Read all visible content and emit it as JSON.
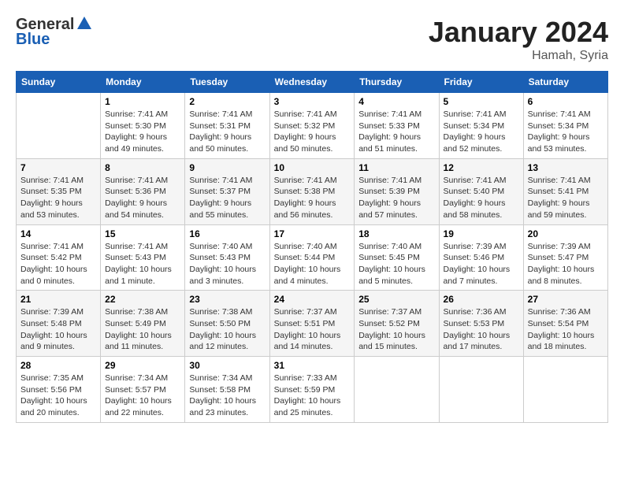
{
  "header": {
    "logo_general": "General",
    "logo_blue": "Blue",
    "month": "January 2024",
    "location": "Hamah, Syria"
  },
  "days_of_week": [
    "Sunday",
    "Monday",
    "Tuesday",
    "Wednesday",
    "Thursday",
    "Friday",
    "Saturday"
  ],
  "weeks": [
    [
      {
        "day": "",
        "sunrise": "",
        "sunset": "",
        "daylight": ""
      },
      {
        "day": "1",
        "sunrise": "Sunrise: 7:41 AM",
        "sunset": "Sunset: 5:30 PM",
        "daylight": "Daylight: 9 hours and 49 minutes."
      },
      {
        "day": "2",
        "sunrise": "Sunrise: 7:41 AM",
        "sunset": "Sunset: 5:31 PM",
        "daylight": "Daylight: 9 hours and 50 minutes."
      },
      {
        "day": "3",
        "sunrise": "Sunrise: 7:41 AM",
        "sunset": "Sunset: 5:32 PM",
        "daylight": "Daylight: 9 hours and 50 minutes."
      },
      {
        "day": "4",
        "sunrise": "Sunrise: 7:41 AM",
        "sunset": "Sunset: 5:33 PM",
        "daylight": "Daylight: 9 hours and 51 minutes."
      },
      {
        "day": "5",
        "sunrise": "Sunrise: 7:41 AM",
        "sunset": "Sunset: 5:34 PM",
        "daylight": "Daylight: 9 hours and 52 minutes."
      },
      {
        "day": "6",
        "sunrise": "Sunrise: 7:41 AM",
        "sunset": "Sunset: 5:34 PM",
        "daylight": "Daylight: 9 hours and 53 minutes."
      }
    ],
    [
      {
        "day": "7",
        "sunrise": "Sunrise: 7:41 AM",
        "sunset": "Sunset: 5:35 PM",
        "daylight": "Daylight: 9 hours and 53 minutes."
      },
      {
        "day": "8",
        "sunrise": "Sunrise: 7:41 AM",
        "sunset": "Sunset: 5:36 PM",
        "daylight": "Daylight: 9 hours and 54 minutes."
      },
      {
        "day": "9",
        "sunrise": "Sunrise: 7:41 AM",
        "sunset": "Sunset: 5:37 PM",
        "daylight": "Daylight: 9 hours and 55 minutes."
      },
      {
        "day": "10",
        "sunrise": "Sunrise: 7:41 AM",
        "sunset": "Sunset: 5:38 PM",
        "daylight": "Daylight: 9 hours and 56 minutes."
      },
      {
        "day": "11",
        "sunrise": "Sunrise: 7:41 AM",
        "sunset": "Sunset: 5:39 PM",
        "daylight": "Daylight: 9 hours and 57 minutes."
      },
      {
        "day": "12",
        "sunrise": "Sunrise: 7:41 AM",
        "sunset": "Sunset: 5:40 PM",
        "daylight": "Daylight: 9 hours and 58 minutes."
      },
      {
        "day": "13",
        "sunrise": "Sunrise: 7:41 AM",
        "sunset": "Sunset: 5:41 PM",
        "daylight": "Daylight: 9 hours and 59 minutes."
      }
    ],
    [
      {
        "day": "14",
        "sunrise": "Sunrise: 7:41 AM",
        "sunset": "Sunset: 5:42 PM",
        "daylight": "Daylight: 10 hours and 0 minutes."
      },
      {
        "day": "15",
        "sunrise": "Sunrise: 7:41 AM",
        "sunset": "Sunset: 5:43 PM",
        "daylight": "Daylight: 10 hours and 1 minute."
      },
      {
        "day": "16",
        "sunrise": "Sunrise: 7:40 AM",
        "sunset": "Sunset: 5:43 PM",
        "daylight": "Daylight: 10 hours and 3 minutes."
      },
      {
        "day": "17",
        "sunrise": "Sunrise: 7:40 AM",
        "sunset": "Sunset: 5:44 PM",
        "daylight": "Daylight: 10 hours and 4 minutes."
      },
      {
        "day": "18",
        "sunrise": "Sunrise: 7:40 AM",
        "sunset": "Sunset: 5:45 PM",
        "daylight": "Daylight: 10 hours and 5 minutes."
      },
      {
        "day": "19",
        "sunrise": "Sunrise: 7:39 AM",
        "sunset": "Sunset: 5:46 PM",
        "daylight": "Daylight: 10 hours and 7 minutes."
      },
      {
        "day": "20",
        "sunrise": "Sunrise: 7:39 AM",
        "sunset": "Sunset: 5:47 PM",
        "daylight": "Daylight: 10 hours and 8 minutes."
      }
    ],
    [
      {
        "day": "21",
        "sunrise": "Sunrise: 7:39 AM",
        "sunset": "Sunset: 5:48 PM",
        "daylight": "Daylight: 10 hours and 9 minutes."
      },
      {
        "day": "22",
        "sunrise": "Sunrise: 7:38 AM",
        "sunset": "Sunset: 5:49 PM",
        "daylight": "Daylight: 10 hours and 11 minutes."
      },
      {
        "day": "23",
        "sunrise": "Sunrise: 7:38 AM",
        "sunset": "Sunset: 5:50 PM",
        "daylight": "Daylight: 10 hours and 12 minutes."
      },
      {
        "day": "24",
        "sunrise": "Sunrise: 7:37 AM",
        "sunset": "Sunset: 5:51 PM",
        "daylight": "Daylight: 10 hours and 14 minutes."
      },
      {
        "day": "25",
        "sunrise": "Sunrise: 7:37 AM",
        "sunset": "Sunset: 5:52 PM",
        "daylight": "Daylight: 10 hours and 15 minutes."
      },
      {
        "day": "26",
        "sunrise": "Sunrise: 7:36 AM",
        "sunset": "Sunset: 5:53 PM",
        "daylight": "Daylight: 10 hours and 17 minutes."
      },
      {
        "day": "27",
        "sunrise": "Sunrise: 7:36 AM",
        "sunset": "Sunset: 5:54 PM",
        "daylight": "Daylight: 10 hours and 18 minutes."
      }
    ],
    [
      {
        "day": "28",
        "sunrise": "Sunrise: 7:35 AM",
        "sunset": "Sunset: 5:56 PM",
        "daylight": "Daylight: 10 hours and 20 minutes."
      },
      {
        "day": "29",
        "sunrise": "Sunrise: 7:34 AM",
        "sunset": "Sunset: 5:57 PM",
        "daylight": "Daylight: 10 hours and 22 minutes."
      },
      {
        "day": "30",
        "sunrise": "Sunrise: 7:34 AM",
        "sunset": "Sunset: 5:58 PM",
        "daylight": "Daylight: 10 hours and 23 minutes."
      },
      {
        "day": "31",
        "sunrise": "Sunrise: 7:33 AM",
        "sunset": "Sunset: 5:59 PM",
        "daylight": "Daylight: 10 hours and 25 minutes."
      },
      {
        "day": "",
        "sunrise": "",
        "sunset": "",
        "daylight": ""
      },
      {
        "day": "",
        "sunrise": "",
        "sunset": "",
        "daylight": ""
      },
      {
        "day": "",
        "sunrise": "",
        "sunset": "",
        "daylight": ""
      }
    ]
  ]
}
